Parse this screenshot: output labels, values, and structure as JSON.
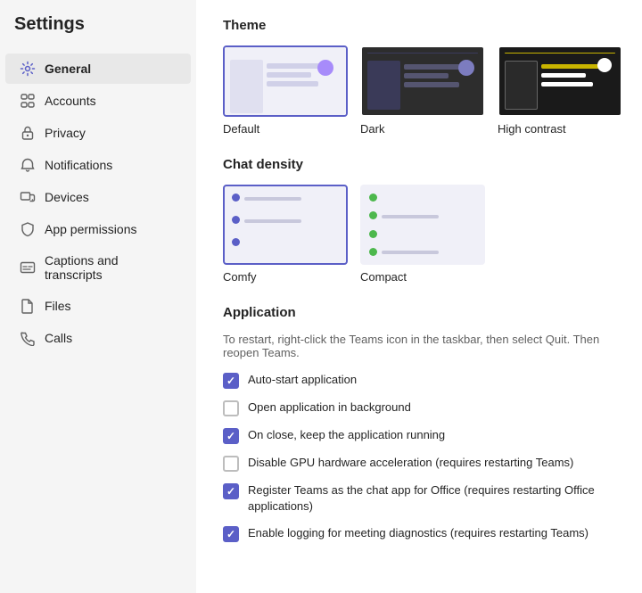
{
  "sidebar": {
    "title": "Settings",
    "items": [
      {
        "id": "general",
        "label": "General",
        "icon": "gear",
        "active": true
      },
      {
        "id": "accounts",
        "label": "Accounts",
        "icon": "accounts"
      },
      {
        "id": "privacy",
        "label": "Privacy",
        "icon": "lock"
      },
      {
        "id": "notifications",
        "label": "Notifications",
        "icon": "bell"
      },
      {
        "id": "devices",
        "label": "Devices",
        "icon": "devices"
      },
      {
        "id": "app-permissions",
        "label": "App permissions",
        "icon": "shield"
      },
      {
        "id": "captions",
        "label": "Captions and transcripts",
        "icon": "captions"
      },
      {
        "id": "files",
        "label": "Files",
        "icon": "file"
      },
      {
        "id": "calls",
        "label": "Calls",
        "icon": "phone"
      }
    ]
  },
  "main": {
    "theme": {
      "title": "Theme",
      "options": [
        {
          "id": "default",
          "label": "Default",
          "selected": true
        },
        {
          "id": "dark",
          "label": "Dark",
          "selected": false
        },
        {
          "id": "high-contrast",
          "label": "High contrast",
          "selected": false
        }
      ]
    },
    "chat_density": {
      "title": "Chat density",
      "options": [
        {
          "id": "comfy",
          "label": "Comfy",
          "selected": true
        },
        {
          "id": "compact",
          "label": "Compact",
          "selected": false
        }
      ]
    },
    "application": {
      "title": "Application",
      "description": "To restart, right-click the Teams icon in the taskbar, then select Quit. Then reopen Teams.",
      "checkboxes": [
        {
          "id": "auto-start",
          "label": "Auto-start application",
          "checked": true
        },
        {
          "id": "open-background",
          "label": "Open application in background",
          "checked": false
        },
        {
          "id": "keep-running",
          "label": "On close, keep the application running",
          "checked": true
        },
        {
          "id": "disable-gpu",
          "label": "Disable GPU hardware acceleration (requires restarting Teams)",
          "checked": false
        },
        {
          "id": "register-teams",
          "label": "Register Teams as the chat app for Office (requires restarting Office applications)",
          "checked": true
        },
        {
          "id": "enable-logging",
          "label": "Enable logging for meeting diagnostics (requires restarting Teams)",
          "checked": true
        }
      ]
    }
  }
}
